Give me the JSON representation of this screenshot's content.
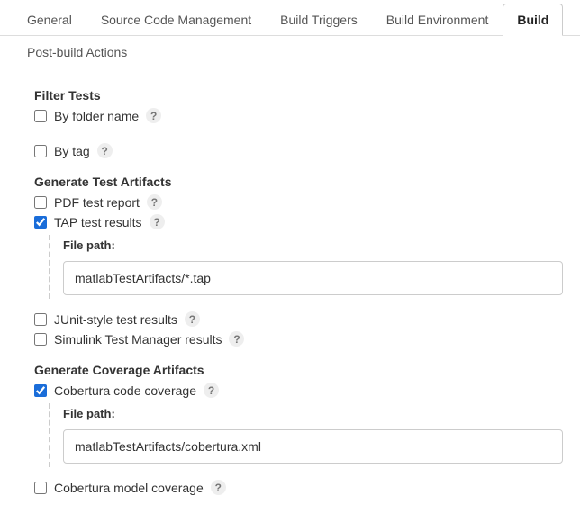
{
  "tabs": {
    "general": "General",
    "scm": "Source Code Management",
    "triggers": "Build Triggers",
    "env": "Build Environment",
    "build": "Build",
    "post": "Post-build Actions"
  },
  "sections": {
    "filter": "Filter Tests",
    "artifacts": "Generate Test Artifacts",
    "coverage": "Generate Coverage Artifacts"
  },
  "options": {
    "by_folder": "By folder name",
    "by_tag": "By tag",
    "pdf": "PDF test report",
    "tap": "TAP test results",
    "junit": "JUnit-style test results",
    "simulink": "Simulink Test Manager results",
    "cobertura_code": "Cobertura code coverage",
    "cobertura_model": "Cobertura model coverage"
  },
  "labels": {
    "file_path": "File path:",
    "help": "?"
  },
  "values": {
    "tap_path": "matlabTestArtifacts/*.tap",
    "cobertura_path": "matlabTestArtifacts/cobertura.xml"
  }
}
